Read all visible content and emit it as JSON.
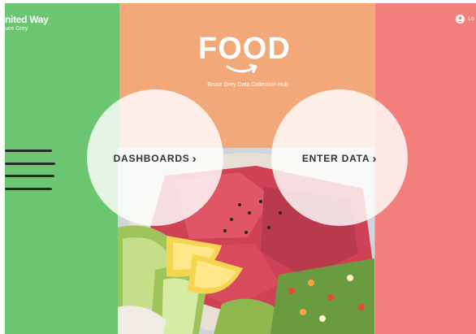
{
  "brand": {
    "name": "nited Way",
    "sub": "uce Grey"
  },
  "login": {
    "label": "Lo",
    "icon": "user-icon"
  },
  "logo": {
    "text": "FOOD",
    "icon": "smile-arrow-icon"
  },
  "hub": {
    "subtitle": "Bruce Grey Data Collection Hub"
  },
  "nav": {
    "dashboards": "DASHBOARDS",
    "enter_data": "ENTER DATA"
  },
  "colors": {
    "left_panel": "#6cc570",
    "center_panel": "#f2a878",
    "right_panel": "#f37f7d"
  }
}
